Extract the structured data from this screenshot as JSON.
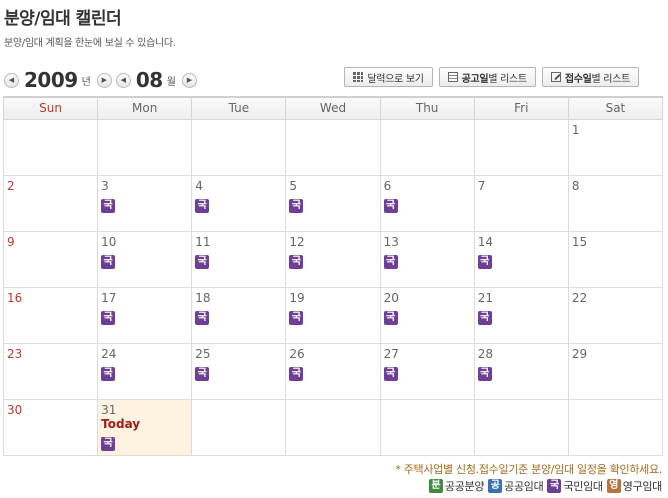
{
  "header": {
    "title": "분양/임대 캘린더",
    "subtitle": "분양/임대 계획을 한눈에 보실 수 있습니다."
  },
  "nav": {
    "prev_year_arrow": "◀",
    "next_year_arrow": "▶",
    "prev_month_arrow": "◀",
    "next_month_arrow": "▶",
    "year": "2009",
    "year_unit": "년",
    "month": "08",
    "month_unit": "월"
  },
  "toolbar": {
    "calendar_view": "달력으로 보기",
    "notice_list_bold": "공고일",
    "notice_list_rest": "별 리스트",
    "receipt_list_bold": "접수일",
    "receipt_list_rest": "별 리스트",
    "icons": {
      "calendar_view": "grid-icon",
      "notice_list": "document-icon",
      "receipt_list": "edit-icon"
    }
  },
  "weekdays": [
    "Sun",
    "Mon",
    "Tue",
    "Wed",
    "Thu",
    "Fri",
    "Sat"
  ],
  "colors": {
    "sunday": "#c0392b",
    "today_bg": "#fdf3e0",
    "today_text": "#a11a1a",
    "national_rental": "#6f3f98",
    "public_sale": "#3f8a3f",
    "public_rental": "#3c6fb0",
    "permanent_rental": "#b8743e"
  },
  "weeks": [
    [
      {
        "day": ""
      },
      {
        "day": ""
      },
      {
        "day": ""
      },
      {
        "day": ""
      },
      {
        "day": ""
      },
      {
        "day": ""
      },
      {
        "day": "1"
      }
    ],
    [
      {
        "day": "2"
      },
      {
        "day": "3",
        "badge": "국"
      },
      {
        "day": "4",
        "badge": "국"
      },
      {
        "day": "5",
        "badge": "국"
      },
      {
        "day": "6",
        "badge": "국"
      },
      {
        "day": "7"
      },
      {
        "day": "8"
      }
    ],
    [
      {
        "day": "9"
      },
      {
        "day": "10",
        "badge": "국"
      },
      {
        "day": "11",
        "badge": "국"
      },
      {
        "day": "12",
        "badge": "국"
      },
      {
        "day": "13",
        "badge": "국"
      },
      {
        "day": "14",
        "badge": "국"
      },
      {
        "day": "15"
      }
    ],
    [
      {
        "day": "16"
      },
      {
        "day": "17",
        "badge": "국"
      },
      {
        "day": "18",
        "badge": "국"
      },
      {
        "day": "19",
        "badge": "국"
      },
      {
        "day": "20",
        "badge": "국"
      },
      {
        "day": "21",
        "badge": "국"
      },
      {
        "day": "22"
      }
    ],
    [
      {
        "day": "23"
      },
      {
        "day": "24",
        "badge": "국"
      },
      {
        "day": "25",
        "badge": "국"
      },
      {
        "day": "26",
        "badge": "국"
      },
      {
        "day": "27",
        "badge": "국"
      },
      {
        "day": "28",
        "badge": "국"
      },
      {
        "day": "29"
      }
    ],
    [
      {
        "day": "30"
      },
      {
        "day": "31",
        "badge": "국",
        "today": "Today"
      },
      {
        "day": ""
      },
      {
        "day": ""
      },
      {
        "day": ""
      },
      {
        "day": ""
      },
      {
        "day": ""
      }
    ]
  ],
  "footer": {
    "note": "* 주택사업별 신청.접수일기준 분양/임대 일정을 확인하세요.",
    "legend": [
      {
        "badge": "분",
        "label": "공공분양",
        "color": "green"
      },
      {
        "badge": "공",
        "label": "공공임대",
        "color": "blue"
      },
      {
        "badge": "국",
        "label": "국민임대",
        "color": "purple"
      },
      {
        "badge": "영",
        "label": "영구임대",
        "color": "orange"
      }
    ]
  }
}
